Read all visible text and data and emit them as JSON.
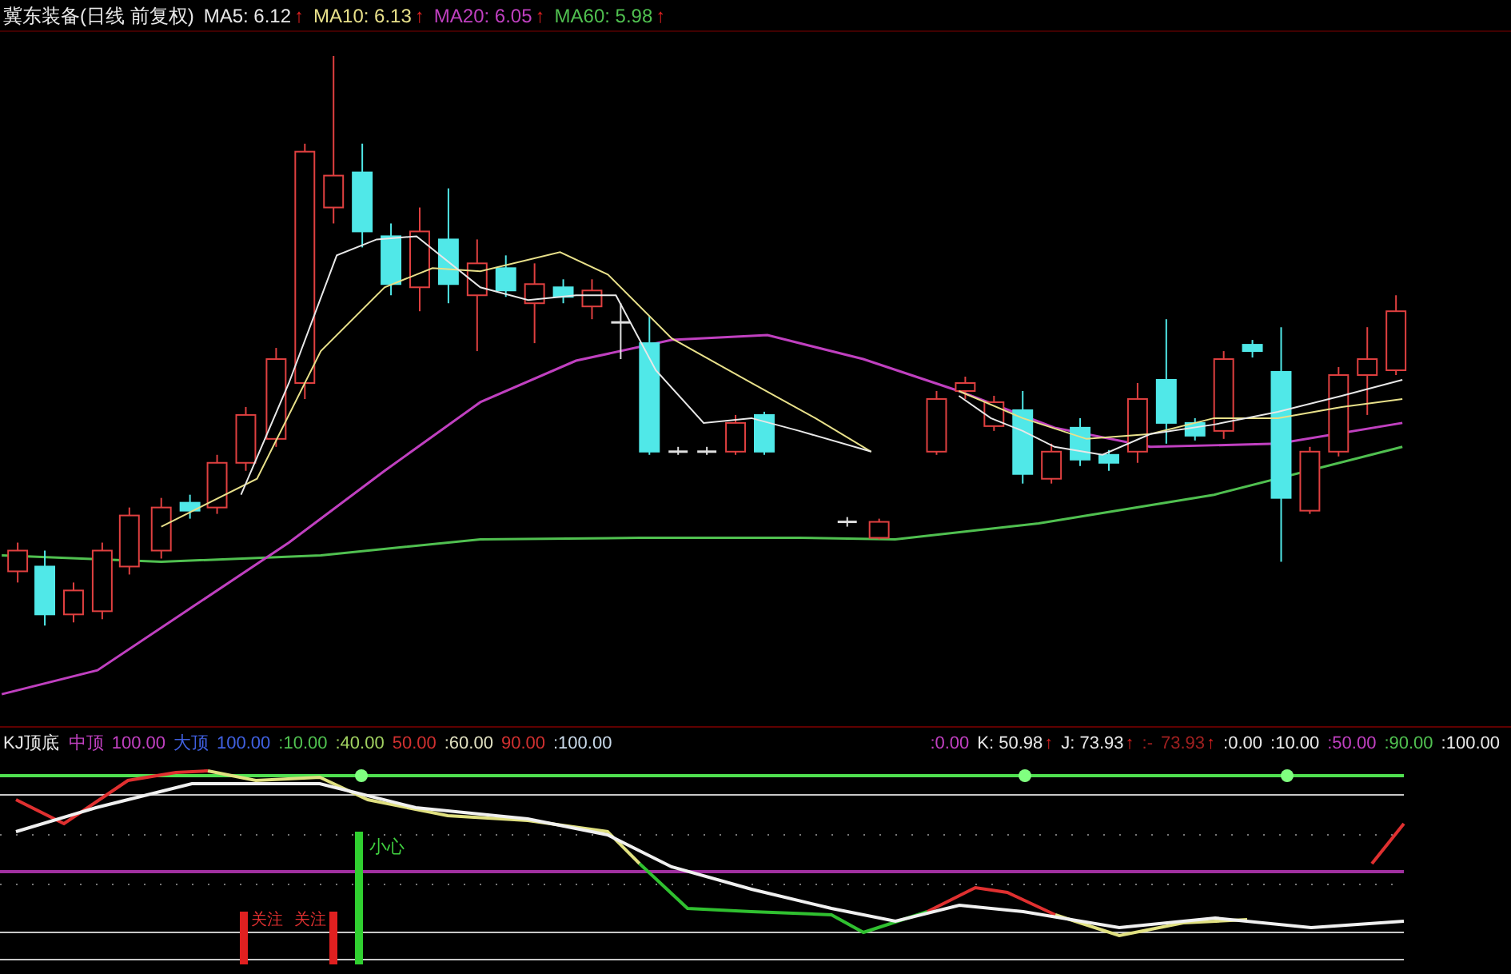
{
  "header": {
    "title": "冀东装备(日线 前复权)",
    "indicators": [
      {
        "label": "MA5: 6.12",
        "arrow": "↑",
        "color": "#e8e8e8"
      },
      {
        "label": "MA10: 6.13",
        "arrow": "↑",
        "color": "#e8e08a"
      },
      {
        "label": "MA20: 6.05",
        "arrow": "↑",
        "color": "#c040c0"
      },
      {
        "label": "MA60: 5.98",
        "arrow": "↑",
        "color": "#50c050"
      }
    ]
  },
  "indicator_panel": {
    "title": "KJ顶底",
    "left_items": [
      {
        "text": "中顶",
        "color": "#c040c0"
      },
      {
        "text": "100.00",
        "color": "#c040c0"
      },
      {
        "text": "大顶",
        "color": "#4060e0"
      },
      {
        "text": "100.00",
        "color": "#4060e0"
      },
      {
        "text": ":10.00",
        "color": "#50c050"
      },
      {
        "text": ":40.00",
        "color": "#a0d060"
      },
      {
        "text": "50.00",
        "color": "#d03030"
      },
      {
        "text": ":60.00",
        "color": "#e0e0c0"
      },
      {
        "text": "90.00",
        "color": "#d03030"
      },
      {
        "text": ":100.00",
        "color": "#c8d8e8"
      }
    ],
    "right_items": [
      {
        "text": ":0.00",
        "color": "#c040c0"
      },
      {
        "text": "K: 50.98",
        "color": "#e8e8e8",
        "arrow": "↑"
      },
      {
        "text": "J: 73.93",
        "color": "#e8e8e8",
        "arrow": "↑"
      },
      {
        "text": ":-",
        "color": "#a02020"
      },
      {
        "text": "73.93",
        "color": "#a02020",
        "arrow": "↑"
      },
      {
        "text": ":0.00",
        "color": "#e8e8e8"
      },
      {
        "text": ":10.00",
        "color": "#e8e8e8"
      },
      {
        "text": ":50.00",
        "color": "#c040c0"
      },
      {
        "text": ":90.00",
        "color": "#50c050"
      },
      {
        "text": ":100.00",
        "color": "#e8e8e8"
      }
    ],
    "annotations": [
      {
        "text": "关注",
        "color": "#e03030"
      },
      {
        "text": "关注",
        "color": "#e03030"
      },
      {
        "text": "小心",
        "color": "#40d040"
      }
    ]
  }
}
